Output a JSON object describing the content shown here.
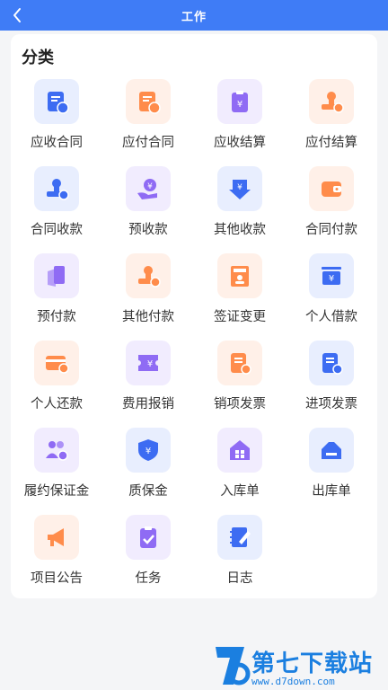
{
  "header": {
    "title": "工作",
    "back_icon": "chevron-left-icon"
  },
  "section": {
    "title": "分类"
  },
  "colors": {
    "header_bg": "#3f7cf6",
    "blue": "#3d6cf2",
    "orange": "#ff8c4b",
    "purple": "#8f6bf4",
    "blue_bg": "#e8eefe",
    "orange_bg": "#fff0e8",
    "purple_bg": "#f1ecfe"
  },
  "items": [
    {
      "key": "receivable-contract",
      "label": "应收合同",
      "icon": "contract-receive-icon",
      "tone": "blue"
    },
    {
      "key": "payable-contract",
      "label": "应付合同",
      "icon": "contract-pay-icon",
      "tone": "orange"
    },
    {
      "key": "receivable-settlement",
      "label": "应收结算",
      "icon": "clipboard-yen-icon",
      "tone": "purple"
    },
    {
      "key": "payable-settlement",
      "label": "应付结算",
      "icon": "stamp-pay-icon",
      "tone": "orange"
    },
    {
      "key": "contract-collection",
      "label": "合同收款",
      "icon": "stamp-receive-icon",
      "tone": "blue"
    },
    {
      "key": "advance-receipt",
      "label": "预收款",
      "icon": "hand-yen-icon",
      "tone": "purple"
    },
    {
      "key": "other-receipt",
      "label": "其他收款",
      "icon": "yen-down-arrow-icon",
      "tone": "blue"
    },
    {
      "key": "contract-payment",
      "label": "合同付款",
      "icon": "wallet-icon",
      "tone": "orange"
    },
    {
      "key": "advance-payment",
      "label": "预付款",
      "icon": "document-layers-icon",
      "tone": "purple"
    },
    {
      "key": "other-payment",
      "label": "其他付款",
      "icon": "stamp-pay-icon",
      "tone": "orange"
    },
    {
      "key": "visa-change",
      "label": "签证变更",
      "icon": "id-card-icon",
      "tone": "orange"
    },
    {
      "key": "personal-loan",
      "label": "个人借款",
      "icon": "money-tray-icon",
      "tone": "blue"
    },
    {
      "key": "personal-repayment",
      "label": "个人还款",
      "icon": "card-return-icon",
      "tone": "orange"
    },
    {
      "key": "expense-reimbursement",
      "label": "费用报销",
      "icon": "ticket-yen-icon",
      "tone": "purple"
    },
    {
      "key": "sales-invoice",
      "label": "销项发票",
      "icon": "invoice-out-icon",
      "tone": "orange"
    },
    {
      "key": "purchase-invoice",
      "label": "进项发票",
      "icon": "invoice-in-icon",
      "tone": "blue"
    },
    {
      "key": "performance-bond",
      "label": "履约保证金",
      "icon": "people-group-icon",
      "tone": "purple"
    },
    {
      "key": "quality-deposit",
      "label": "质保金",
      "icon": "shield-yen-icon",
      "tone": "blue"
    },
    {
      "key": "stock-in",
      "label": "入库单",
      "icon": "warehouse-in-icon",
      "tone": "purple"
    },
    {
      "key": "stock-out",
      "label": "出库单",
      "icon": "warehouse-out-icon",
      "tone": "blue"
    },
    {
      "key": "project-announcement",
      "label": "项目公告",
      "icon": "megaphone-icon",
      "tone": "orange"
    },
    {
      "key": "task",
      "label": "任务",
      "icon": "clipboard-check-icon",
      "tone": "purple"
    },
    {
      "key": "log",
      "label": "日志",
      "icon": "notebook-pen-icon",
      "tone": "blue"
    }
  ],
  "watermark": {
    "title": "第七下载站",
    "url": "www.d7down.com"
  }
}
